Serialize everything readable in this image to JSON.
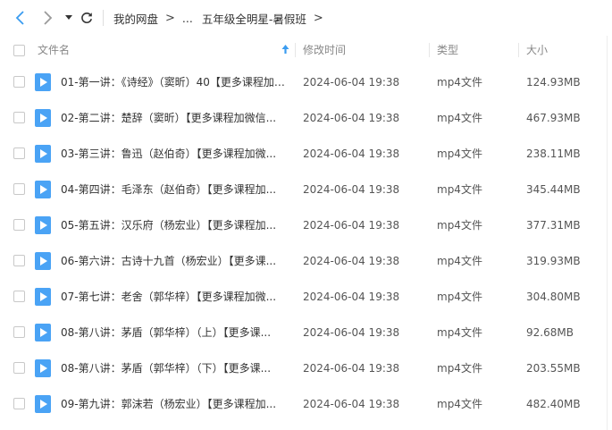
{
  "nav": {
    "back_icon": "chevron-left-icon",
    "forward_icon": "chevron-right-icon",
    "history_icon": "dropdown-caret-icon",
    "refresh_icon": "refresh-icon"
  },
  "breadcrumb": {
    "root": "我的网盘",
    "separator": ">",
    "ellipsis": "...",
    "current": "五年级全明星-暑假班"
  },
  "columns": {
    "name": "文件名",
    "modified": "修改时间",
    "type": "类型",
    "size": "大小",
    "sort_icon": "sort-arrow-up-icon"
  },
  "colors": {
    "accent": "#3b9cf0",
    "icon_blue": "#4aa3f5"
  },
  "files": [
    {
      "name": "01-第一讲：《诗经》（窦昕）40【更多课程加微信...",
      "modified": "2024-06-04 19:38",
      "type": "mp4文件",
      "size": "124.93MB"
    },
    {
      "name": "02-第二讲：楚辞（窦昕）【更多课程加微信...",
      "modified": "2024-06-04 19:38",
      "type": "mp4文件",
      "size": "467.93MB"
    },
    {
      "name": "03-第三讲：鲁迅（赵伯奇）【更多课程加微...",
      "modified": "2024-06-04 19:38",
      "type": "mp4文件",
      "size": "238.11MB"
    },
    {
      "name": "04-第四讲：毛泽东（赵伯奇）【更多课程加...",
      "modified": "2024-06-04 19:38",
      "type": "mp4文件",
      "size": "345.44MB"
    },
    {
      "name": "05-第五讲：汉乐府（杨宏业）【更多课程加...",
      "modified": "2024-06-04 19:38",
      "type": "mp4文件",
      "size": "377.31MB"
    },
    {
      "name": "06-第六讲：古诗十九首（杨宏业）【更多课...",
      "modified": "2024-06-04 19:38",
      "type": "mp4文件",
      "size": "319.93MB"
    },
    {
      "name": "07-第七讲：老舍（郭华梓）【更多课程加微...",
      "modified": "2024-06-04 19:38",
      "type": "mp4文件",
      "size": "304.80MB"
    },
    {
      "name": "08-第八讲：茅盾（郭华梓）（上）【更多课...",
      "modified": "2024-06-04 19:38",
      "type": "mp4文件",
      "size": "92.68MB"
    },
    {
      "name": "08-第八讲：茅盾（郭华梓）（下）【更多课...",
      "modified": "2024-06-04 19:38",
      "type": "mp4文件",
      "size": "203.55MB"
    },
    {
      "name": "09-第九讲：郭沫若（杨宏业）【更多课程加...",
      "modified": "2024-06-04 19:38",
      "type": "mp4文件",
      "size": "482.40MB"
    }
  ]
}
